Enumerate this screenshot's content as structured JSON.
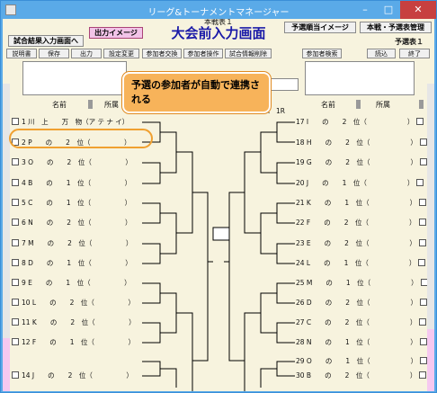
{
  "window": {
    "title": "リーグ&トーナメントマネージャー"
  },
  "header": {
    "result_input_btn": "試合結果入力画面へ",
    "output_image_btn": "出力イメージ",
    "small_title": "本戦表１",
    "big_title": "大会前入力画面",
    "prelim_image_btn": "予選順当イメージ",
    "main_prelim_mgmt_btn": "本戦・予選表管理",
    "prelim_table_label": "予選表１"
  },
  "toolbar": [
    "説明書",
    "保存",
    "出力",
    "設定変更",
    "参加者交換",
    "参加者操作",
    "試合情報削除",
    "参加者検索",
    "読込",
    "終了"
  ],
  "columns": {
    "left_name": "名前",
    "left_affil": "所属",
    "right_name": "名前",
    "right_affil": "所属"
  },
  "rounds_left": [
    "1R",
    "2R",
    "3R",
    "SF",
    "F"
  ],
  "rounds_right": [
    "SF",
    "3R",
    "2R",
    "1R"
  ],
  "callout": "予選の参加者が自動で連携される",
  "left_entries": [
    "1 川　上　　万　物（ア テ ナ イ）",
    "2 P　　の　　2　位（　　　　　）",
    "3 O　　の　　2　位（　　　　　）",
    "4 B　　の　　1　位（　　　　　）",
    "5 C　　の　　1　位（　　　　　）",
    "6 N　　の　　2　位（　　　　　）",
    "7 M　　の　　2　位（　　　　　）",
    "8 D　　の　　1　位（　　　　　）",
    "9 E　　の　　1　位（　　　　　）",
    "10 L　　の　　2　位（　　　　　）",
    "11 K　　の　　2　位（　　　　　）",
    "12 F　　の　　1　位（　　　　　）",
    "14 J　　の　　2　位（　　　　　）"
  ],
  "right_entries": [
    "17 I　　の　　2　位（　　　　　　）",
    "18 H　　の　　2　位（　　　　　　）",
    "19 G　　の　　2　位（　　　　　　）",
    "20 J　　の　　1　位（　　　　　　）",
    "21 K　　の　　1　位（　　　　　　）",
    "22 F　　の　　2　位（　　　　　　）",
    "23 E　　の　　2　位（　　　　　　）",
    "24 L　　の　　1　位（　　　　　　）",
    "25 M　　の　　1　位（　　　　　　）",
    "26 D　　の　　2　位（　　　　　　）",
    "27 C　　の　　2　位（　　　　　　）",
    "28 N　　の　　1　位（　　　　　　）",
    "29 O　　の　　1　位（　　　　　　）",
    "30 B　　の　　2　位（　　　　　　）"
  ]
}
